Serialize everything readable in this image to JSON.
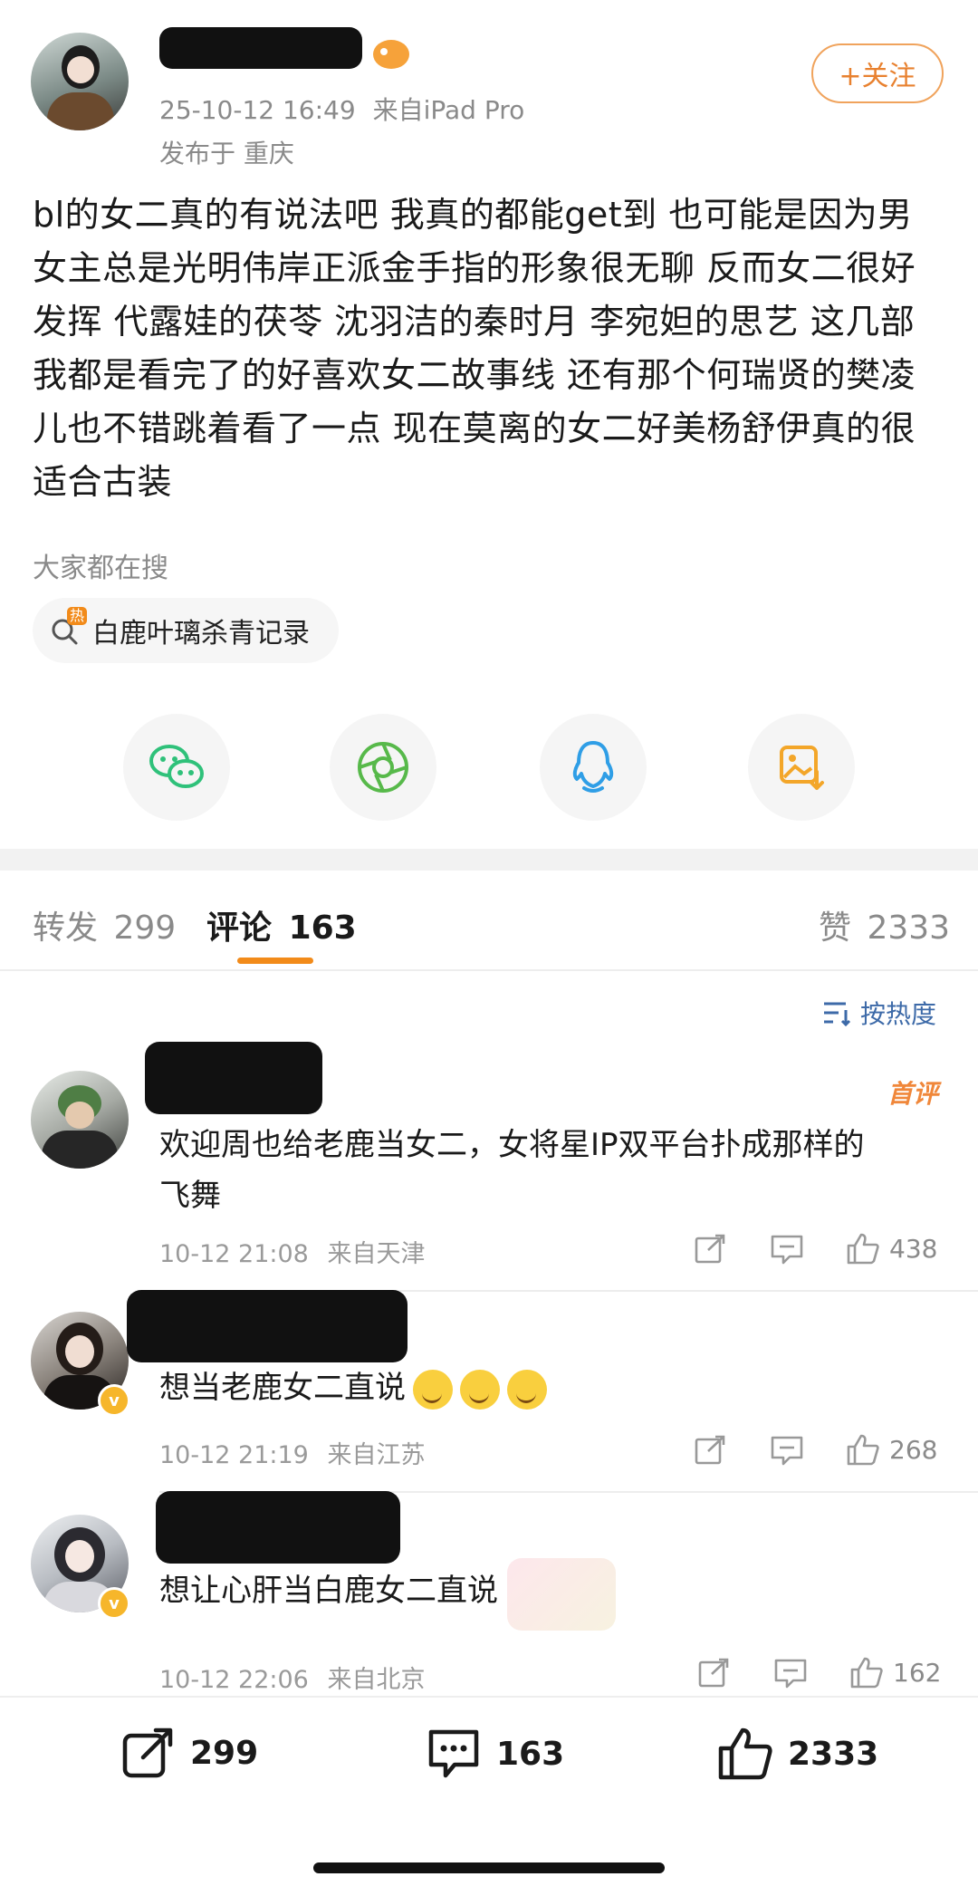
{
  "post": {
    "timestamp": "25-10-12 16:49",
    "source": "来自iPad Pro",
    "location": "发布于 重庆",
    "follow_label": "+关注",
    "lines": [
      "bl的女二真的有说法吧 我真的都能get到 也可能是因为男",
      "女主总是光明伟岸正派金手指的形象很无聊 反而女二很好",
      "发挥 代露娃的茯苓 沈羽洁的秦时月 李宛妲的思艺 这几部",
      "我都是看完了的好喜欢女二故事线 还有那个何瑞贤的樊凌",
      "儿也不错跳着看了一点 现在莫离的女二好美杨舒伊真的很",
      "适合古装"
    ]
  },
  "hot_search": {
    "heading": "大家都在搜",
    "badge": "热",
    "chip_label": "白鹿叶璃杀青记录"
  },
  "share_icons": [
    "wechat-icon",
    "moments-icon",
    "qq-icon",
    "save-image-icon"
  ],
  "tabs": {
    "repost_label": "转发",
    "repost_count": "299",
    "comment_label": "评论",
    "comment_count": "163",
    "like_label": "赞",
    "like_count": "2333"
  },
  "sort_label": "按热度",
  "comments": [
    {
      "badge": "首评",
      "line1": "欢迎周也给老鹿当女二，女将星IP双平台扑成那样的",
      "line2": "飞舞",
      "time": "10-12 21:08",
      "location": "来自天津",
      "likes": "438"
    },
    {
      "line1": "想当老鹿女二直说",
      "time": "10-12 21:19",
      "location": "来自江苏",
      "likes": "268"
    },
    {
      "line1": "想让心肝当白鹿女二直说",
      "time": "10-12 22:06",
      "location": "来自北京",
      "likes": "162"
    }
  ],
  "bottom_bar": {
    "repost": "299",
    "comment": "163",
    "like": "2333"
  },
  "colors": {
    "accent": "#f28b1a",
    "link_blue": "#3d6aa8",
    "wechat_green": "#2fc17a",
    "qq_blue": "#2f9ee6",
    "save_orange": "#f3a629"
  }
}
